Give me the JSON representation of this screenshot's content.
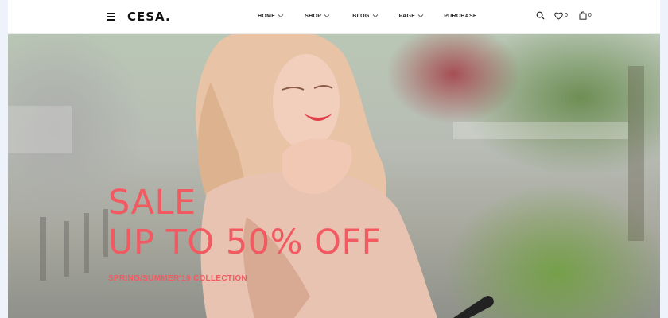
{
  "brand": {
    "logo": "CESA."
  },
  "nav": {
    "items": [
      {
        "label": "HOME",
        "has_dropdown": true
      },
      {
        "label": "SHOP",
        "has_dropdown": true
      },
      {
        "label": "BLOG",
        "has_dropdown": true
      },
      {
        "label": "PAGE",
        "has_dropdown": true
      },
      {
        "label": "PURCHASE",
        "has_dropdown": false
      }
    ]
  },
  "header_icons": {
    "search": {
      "icon": "search-icon"
    },
    "wishlist": {
      "icon": "heart-icon",
      "count": "0"
    },
    "cart": {
      "icon": "shopping-bag-icon",
      "count": "0"
    }
  },
  "hero": {
    "title_line1": "SALE",
    "title_line2": "UP TO 50% OFF",
    "subtitle": "SPRING/SUMMER'19 COLLECTION",
    "accent_color": "#f25a62",
    "image": "woman-smiling-photo"
  }
}
